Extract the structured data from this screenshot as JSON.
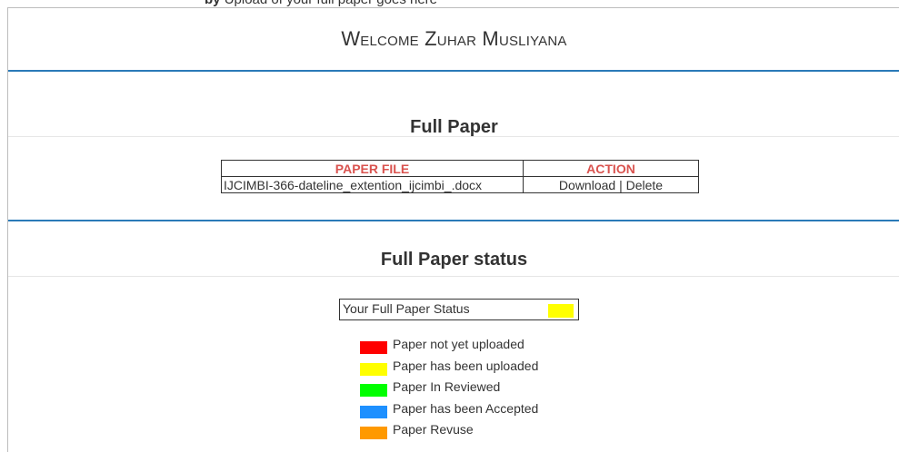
{
  "top_strip": {
    "bold_part": "by",
    "rest": "Upload of your full paper goes here"
  },
  "welcome": "Welcome Zuhar Musliyana",
  "full_paper": {
    "title": "Full Paper",
    "headers": [
      "PAPER FILE",
      "ACTION"
    ],
    "rows": [
      {
        "file": "IJCIMBI-366-dateline_extention_ijcimbi_.docx",
        "download": "Download",
        "separator": " | ",
        "delete": "Delete"
      }
    ]
  },
  "full_paper_status": {
    "title": "Full Paper status",
    "status_label": "Your Full Paper Status",
    "current_status_color": "#ffff00",
    "legend": [
      {
        "color": "#ff0000",
        "label": "Paper not yet uploaded"
      },
      {
        "color": "#ffff00",
        "label": "Paper has been uploaded"
      },
      {
        "color": "#00ff00",
        "label": "Paper In Reviewed"
      },
      {
        "color": "#1e90ff",
        "label": "Paper has been Accepted"
      },
      {
        "color": "#ff9900",
        "label": "Paper Revuse"
      }
    ]
  }
}
